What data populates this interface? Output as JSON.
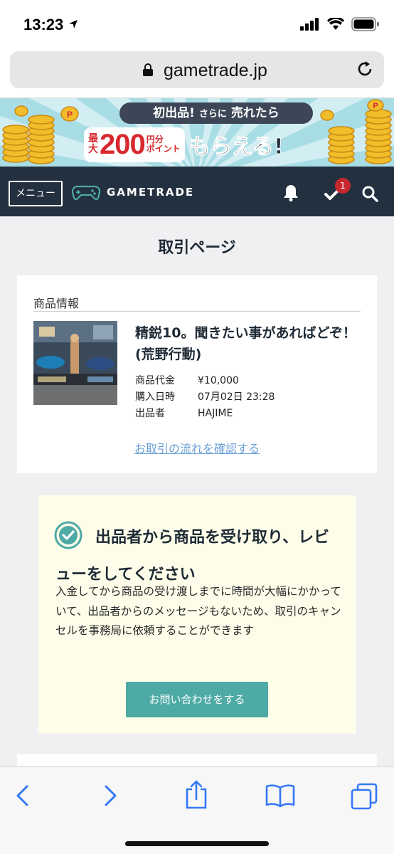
{
  "status": {
    "time": "13:23"
  },
  "browser": {
    "url": "gametrade.jp"
  },
  "banner": {
    "tag_a": "初出品!",
    "tag_b": "さらに",
    "tag_c": "売れたら",
    "prefix": "最大",
    "amount": "200",
    "unit_a": "円分",
    "unit_b": "ポイント",
    "suffix": "もらえる!"
  },
  "navbar": {
    "menu_label": "メニュー",
    "logo_text": "GAMETRADE",
    "badge_count": "1"
  },
  "page": {
    "title": "取引ページ"
  },
  "product": {
    "section_label": "商品情報",
    "title": "精鋭10。聞きたい事があればどぞ！(荒野行動)",
    "rows": [
      {
        "key": "商品代金",
        "value": "¥10,000"
      },
      {
        "key": "購入日時",
        "value": "07月02日 23:28"
      },
      {
        "key": "出品者",
        "value": "HAJIME"
      }
    ],
    "flow_link": "お取引の流れを確認する"
  },
  "notice": {
    "title": "出品者から商品を受け取り、レビューをしてください",
    "body": "入金してから商品の受け渡しまでに時間が大幅にかかっていて、出品者からのメッセージもないため、取引のキャンセルを事務局に依頼することができます",
    "button_label": "お問い合わせをする"
  },
  "colors": {
    "navbar_bg": "#23303f",
    "accent_teal": "#4eaaa5",
    "link_blue": "#6a9fd6",
    "badge_red": "#c7282f",
    "notice_bg": "#fdfde9"
  }
}
